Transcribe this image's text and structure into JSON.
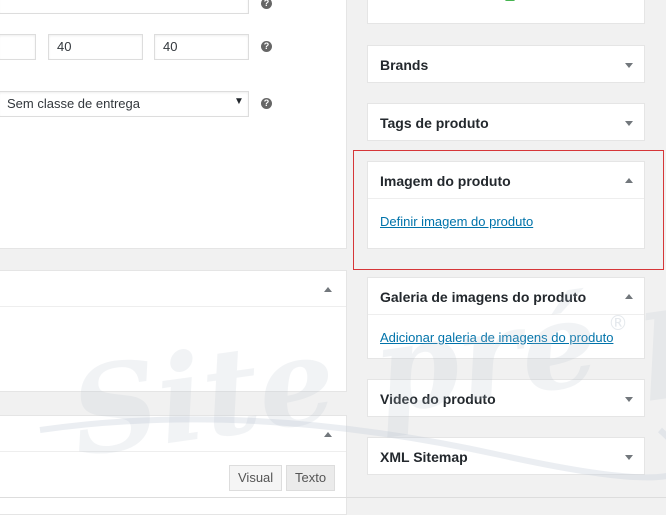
{
  "shipping": {
    "dimension_values": [
      "",
      "40",
      "40"
    ],
    "shipping_class_selected": "Sem classe de entrega"
  },
  "sidebar": {
    "boxes": [
      {
        "title": "Brands",
        "expanded": false
      },
      {
        "title": "Tags de produto",
        "expanded": false
      },
      {
        "title": "Imagem do produto",
        "expanded": true,
        "link": "Definir imagem do produto",
        "highlighted": true
      },
      {
        "title": "Galeria de imagens do produto",
        "expanded": true,
        "link": "Adicionar galeria de imagens do produto"
      },
      {
        "title": "Video do produto",
        "expanded": false
      },
      {
        "title": "XML Sitemap",
        "expanded": false
      }
    ]
  },
  "editor": {
    "tabs": [
      "Visual",
      "Texto"
    ]
  },
  "watermark": {
    "text": "Site pré pago",
    "registered": "®"
  },
  "colors": {
    "highlight_border": "#d63638",
    "link": "#0073aa"
  }
}
